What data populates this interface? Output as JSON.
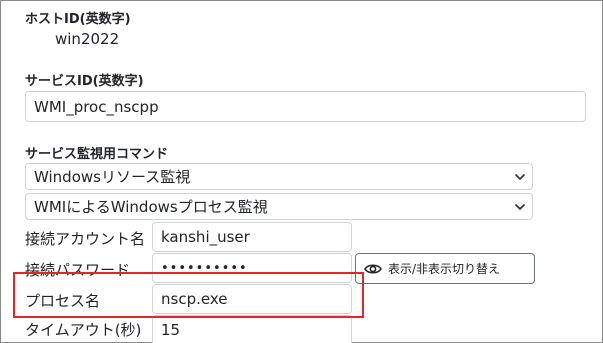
{
  "host_id": {
    "label": "ホストID(英数字)",
    "value": "win2022"
  },
  "service_id": {
    "label": "サービスID(英数字)",
    "value": "WMI_proc_nscpp"
  },
  "monitor_command": {
    "label": "サービス監視用コマンド",
    "category_selected": "Windowsリソース監視",
    "command_selected": "WMIによるWindowsプロセス監視"
  },
  "fields": {
    "account_label": "接続アカウント名",
    "account_value": "kanshi_user",
    "password_label": "接続パスワード",
    "password_value": "••••••••••",
    "toggle_label": "表示/非表示切り替え",
    "process_label": "プロセス名",
    "process_value": "nscp.exe",
    "timeout_label": "タイムアウト(秒)",
    "timeout_value": "15"
  },
  "icons": {
    "eye": "eye-icon",
    "chevron": "chevron-down-icon"
  },
  "colors": {
    "highlight": "#e0262f",
    "border": "#ced4da"
  }
}
